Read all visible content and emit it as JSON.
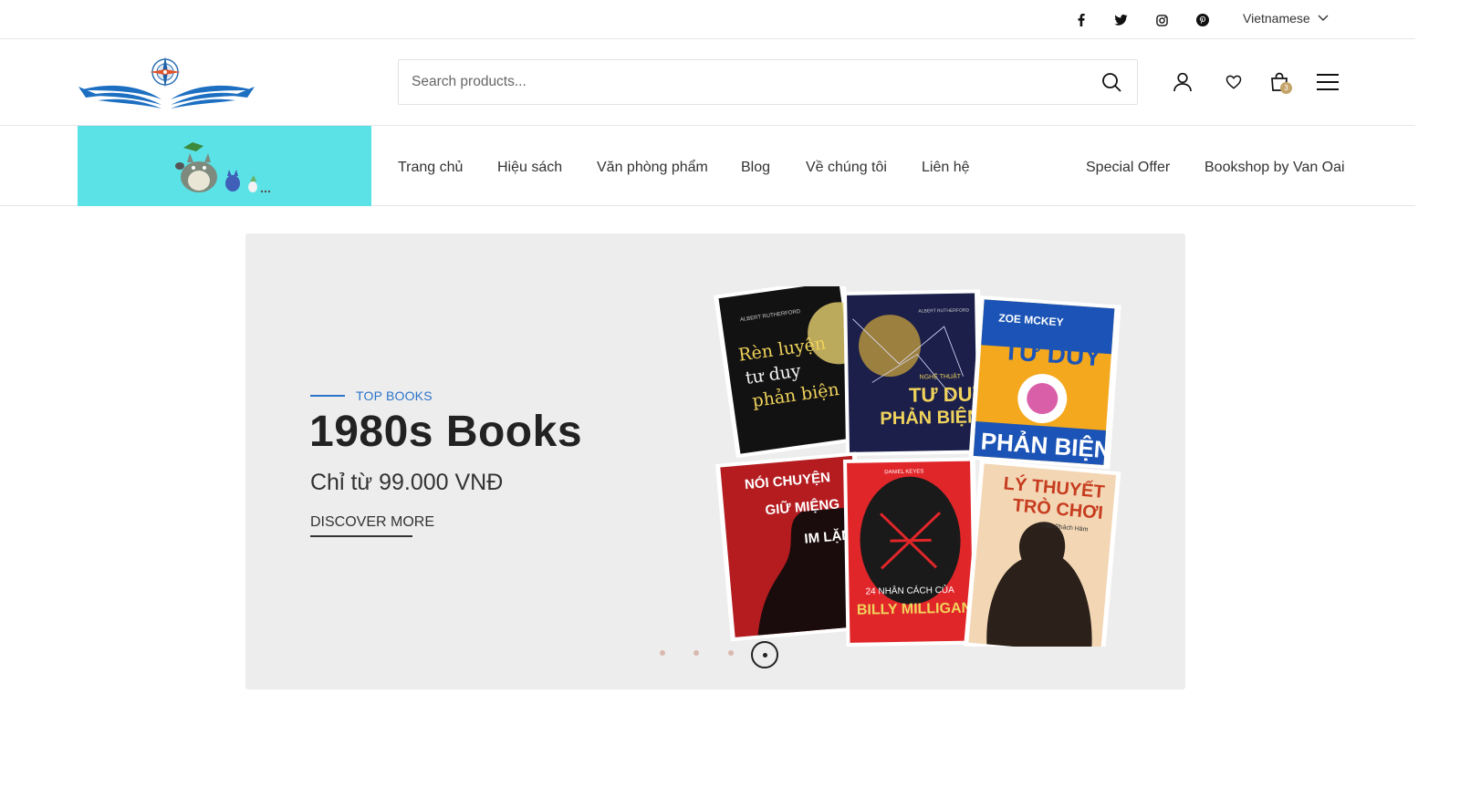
{
  "topbar": {
    "social": [
      "facebook-icon",
      "twitter-icon",
      "instagram-icon",
      "pinterest-icon"
    ],
    "language": "Vietnamese"
  },
  "header": {
    "search": {
      "placeholder": "Search products...",
      "value": ""
    },
    "cart_count": "3",
    "icons": [
      "account-icon",
      "wishlist-icon",
      "cart-icon",
      "menu-icon"
    ]
  },
  "nav": {
    "left_items": [
      "Trang chủ",
      "Hiệu sách",
      "Văn phòng phẩm",
      "Blog",
      "Về chúng tôi",
      "Liên hệ"
    ],
    "right_items": [
      "Special Offer",
      "Bookshop by Van Oai"
    ]
  },
  "hero": {
    "eyebrow": "TOP BOOKS",
    "title": "1980s Books",
    "subtitle": "Chỉ từ 99.000 VNĐ",
    "cta": "DISCOVER MORE",
    "books": [
      {
        "lines": [
          "Rèn luyện",
          "tư duy",
          "phản biện"
        ],
        "author": "ALBERT RUTHERFORD"
      },
      {
        "lines": [
          "NGHỆ THUẬT",
          "TƯ DUY",
          "PHẢN BIỆN"
        ],
        "author": "ALBERT RUTHERFORD"
      },
      {
        "lines": [
          "TƯ DUY",
          "PHẢN BIỆN"
        ],
        "author": "ZOE MCKEY"
      },
      {
        "lines": [
          "NÓI CHUYỆN",
          "GIỮ MIỆNG",
          "IM LẶNG"
        ],
        "author": ""
      },
      {
        "lines": [
          "24 NHÂN CÁCH CỦA",
          "BILLY MILLIGAN"
        ],
        "author": "DANIEL KEYES"
      },
      {
        "lines": [
          "LÝ THUYẾT",
          "TRÒ CHƠI"
        ],
        "author": "Trần Phách Hàm"
      }
    ],
    "slides": 4,
    "active_slide": 4
  },
  "colors": {
    "accent_blue": "#2b74c9",
    "nav_banner": "#5be2e6",
    "hero_bg": "#ededed",
    "badge": "#c5a46a"
  }
}
